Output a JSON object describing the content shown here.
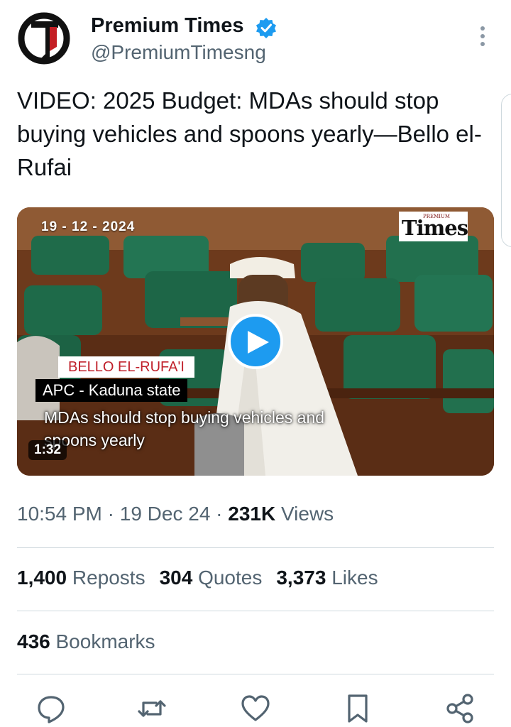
{
  "author": {
    "name": "Premium Times",
    "handle": "@PremiumTimesng",
    "avatar_letter": "T",
    "verified_color": "#1d9bf0"
  },
  "tweet": {
    "text": "VIDEO: 2025 Budget: MDAs should stop buying vehicles and spoons yearly—Bello el-Rufai"
  },
  "video": {
    "date": "19 - 12 - 2024",
    "logo_small": "PREMIUM",
    "logo_main": "Times",
    "name_tag": "BELLO EL-RUFA'I",
    "party_tag": "APC - Kaduna state",
    "caption": "MDAs should stop buying vehicles and spoons yearly",
    "duration": "1:32"
  },
  "meta": {
    "time": "10:54 PM",
    "separator": " · ",
    "date": "19 Dec 24",
    "views_count": "231K",
    "views_label": "Views"
  },
  "stats": {
    "reposts_count": "1,400",
    "reposts_label": "Reposts",
    "quotes_count": "304",
    "quotes_label": "Quotes",
    "likes_count": "3,373",
    "likes_label": "Likes",
    "bookmarks_count": "436",
    "bookmarks_label": "Bookmarks"
  },
  "actions": [
    "reply-icon",
    "repost-icon",
    "like-icon",
    "bookmark-icon",
    "share-icon"
  ],
  "colors": {
    "accent": "#1d9bf0",
    "secondary_text": "#536471",
    "primary_text": "#0f1419",
    "divider": "#cfd9de"
  }
}
